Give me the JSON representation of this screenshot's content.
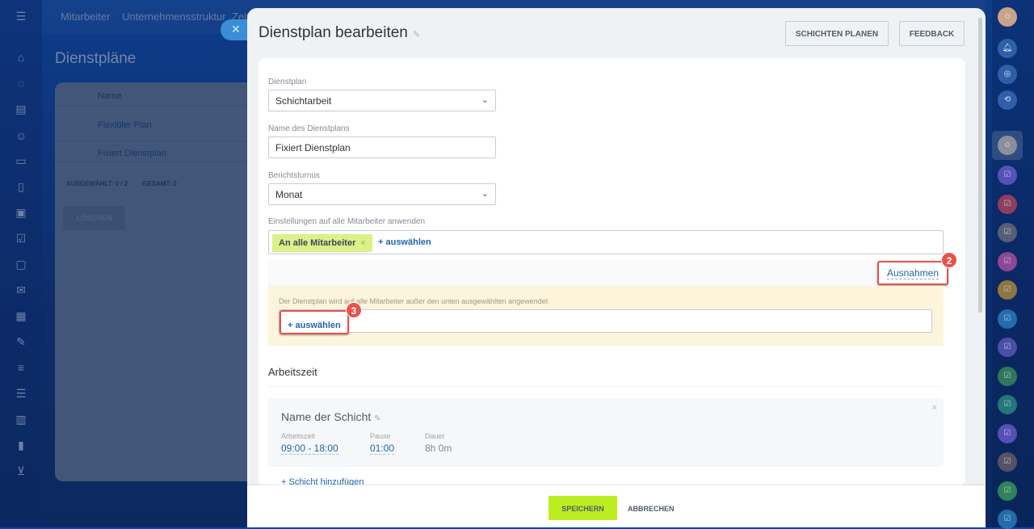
{
  "background": {
    "nav": [
      "Mitarbeiter",
      "Unternehmensstruktur",
      "Zeit"
    ],
    "title": "Dienstpläne",
    "table": {
      "header": "Name",
      "rows": [
        "Flexibler Plan",
        "Fixiert Dienstplan"
      ],
      "selected_label": "AUSGEWÄHLT:",
      "selected_value": "0 / 2",
      "total_label": "GESAMT:",
      "total_value": "2",
      "delete": "LÖSCHEN"
    }
  },
  "modal": {
    "title": "Dienstplan bearbeiten",
    "plan_shifts": "SCHICHTEN PLANEN",
    "feedback": "FEEDBACK",
    "fields": {
      "type_label": "Dienstplan",
      "type_value": "Schichtarbeit",
      "name_label": "Name des Dienstplans",
      "name_value": "Fixiert Dienstplan",
      "period_label": "Berichtsturnus",
      "period_value": "Monat",
      "apply_label": "Einstellungen auf alle Mitarbeiter anwenden",
      "tag": "An alle Mitarbeiter",
      "add": "+ auswählen"
    },
    "exceptions": {
      "link": "Ausnahmen",
      "info": "Der Dienstplan wird auf alle Mitarbeiter außer den unten ausgewählten angewendet",
      "add": "+ auswählen",
      "badge2": "2",
      "badge3": "3"
    },
    "worktime": {
      "heading": "Arbeitszeit",
      "shift_name": "Name der Schicht",
      "time_label": "Arbeitszeit",
      "time_value": "09:00 - 18:00",
      "pause_label": "Pause",
      "pause_value": "01:00",
      "duration_label": "Dauer",
      "duration_value": "8h 0m",
      "add_shift": "+ Schicht hinzufügen"
    },
    "footer": {
      "save": "SPEICHERN",
      "cancel": "ABBRECHEN"
    }
  },
  "right_colors": [
    "#6a5acd",
    "#b0435a",
    "#6b6b7a",
    "#b04fa0",
    "#b08a3a",
    "#2a7dc0",
    "#5a58b8",
    "#3a8a5a",
    "#2a8a80",
    "#6a5acd",
    "#6b5b6a",
    "#3a9a5a",
    "#2a7dc0"
  ]
}
